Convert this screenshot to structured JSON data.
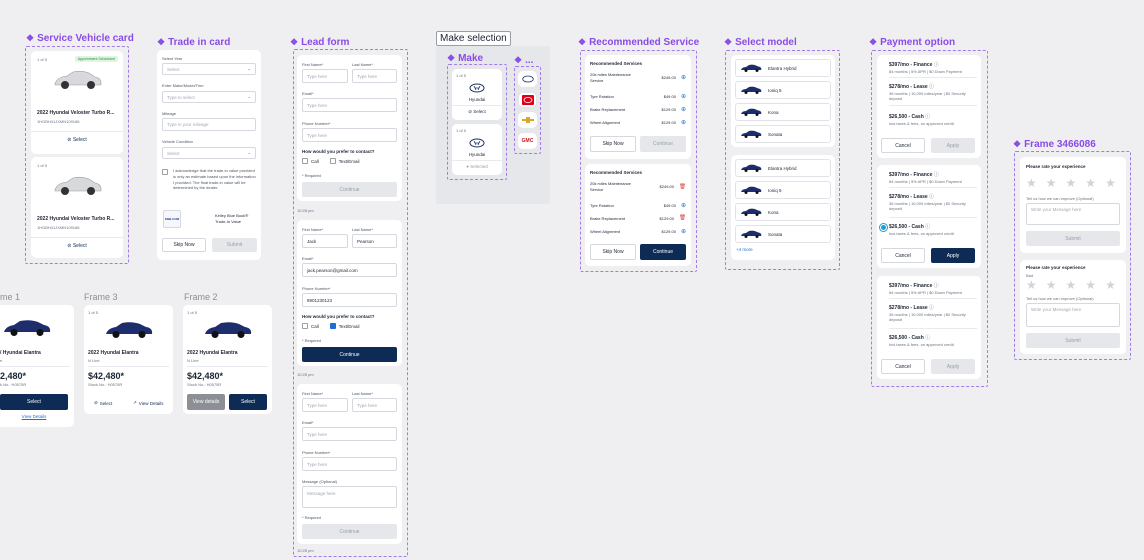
{
  "titles": {
    "service_vehicle_card": "Service Vehicle card",
    "trade_in_card": "Trade in card",
    "lead_form": "Lead form",
    "make_selection": "Make selection",
    "make": "Make",
    "make_more": "...",
    "recommended_service": "Recommended Service",
    "select_model": "Select model",
    "payment_option": "Payment option",
    "frame_3466086": "Frame 3466086",
    "frame_1": "me 1",
    "frame_3": "Frame 3",
    "frame_2": "Frame 2"
  },
  "service_vehicle": {
    "cards": [
      {
        "counter": "1 of 5",
        "badge": "Appointment Scheduled",
        "name": "2022 Hyundai Veloster Turbo R...",
        "vin": "1HGBH41JXMN109186",
        "select": "Select"
      },
      {
        "counter": "1 of 5",
        "name": "2022 Hyundai Veloster Turbo R...",
        "vin": "1HGBH41JXMN109186",
        "select": "Select"
      }
    ]
  },
  "trade_in": {
    "year_label": "Select Year",
    "year_ph": "Select",
    "mmt_label": "Enter Make/Model/Trim",
    "mmt_ph": "Type to select",
    "mileage_label": "Mileage",
    "mileage_ph": "Type in your mileage",
    "condition_label": "Vehicle Condition",
    "condition_ph": "Select",
    "ack": "I acknowledge that the trade-in value provided is only an estimate based upon the information I provided. The final trade-in value will be determined by the dealer.",
    "kbb_logo": "KBB.COM",
    "kbb_text": "Kelley Blue Book® Trade-In Value",
    "skip": "Skip Now",
    "submit": "Submit"
  },
  "lead_form": {
    "first_label": "First Name*",
    "last_label": "Last Name*",
    "email_label": "Email*",
    "phone_label": "Phone Number*",
    "ph_type": "Type here",
    "ph_email": "Type here",
    "ph_phone": "Type here",
    "prefer": "How would you prefer to contact?",
    "call": "Call",
    "text_email": "Text/Email",
    "required": "* Required",
    "continue": "Continue",
    "time1": "10:28 pm",
    "time2": "10:28 pm",
    "time3": "10:28 pm",
    "first_value": "Jack",
    "last_value": "Pearson",
    "email_value": "jack.pearson@gmail.com",
    "phone_value": "8901230123",
    "message_label": "Message (Optional)",
    "message_ph": "Message here"
  },
  "make": {
    "cards": [
      {
        "counter": "1 of 5",
        "name": "Hyundai",
        "action": "Select"
      },
      {
        "counter": "1 of 5",
        "name": "Hyundai",
        "action": "Selected"
      }
    ],
    "logos": [
      "hyundai-logo",
      "toyota-logo",
      "chevrolet-logo",
      "gmc-logo"
    ]
  },
  "recommended": {
    "heading": "Recommended Services",
    "items": [
      {
        "name": "20k miles Maintenance Service",
        "price": "$249.00"
      },
      {
        "name": "Tyre Rotation",
        "price": "$49.00"
      },
      {
        "name": "Brake Replacement",
        "price": "$129.00"
      },
      {
        "name": "Wheel Alignment",
        "price": "$129.00"
      }
    ],
    "skip": "Skip Now",
    "continue": "Continue"
  },
  "models": {
    "list1": [
      "Elantra Hybrid",
      "Ioniq 5",
      "Kona",
      "Sonata"
    ],
    "list2": [
      "Elantra Hybrid",
      "Ioniq 5",
      "Kona",
      "Sonata"
    ],
    "more": "+4 more"
  },
  "payment": {
    "options": [
      {
        "title": "$397/mo - Finance",
        "sub": "84 months | 5% APR | $0 Down Payment"
      },
      {
        "title": "$278/mo - Lease",
        "sub": "36 months | 10,000 miles/year | $0 Security deposit"
      },
      {
        "title": "$26,500 - Cash",
        "sub": "Incl.taxes & fees, on approved credit"
      }
    ],
    "cancel": "Cancel",
    "apply": "Apply"
  },
  "rating": {
    "title": "Please rate your experience",
    "rating_word": "Bad",
    "improve": "Tell us how we can improve (Optional)",
    "ph": "Write your Message here",
    "submit": "Submit"
  },
  "listing": {
    "counter": "1 of 5",
    "name": "2022 Hyundai Elantra",
    "trim": "N Line",
    "price": "$42,480*",
    "stock": "Stock No.: H0575R",
    "name_cut": "/ Hyundai Elantra",
    "trim_cut": "e",
    "price_cut": "2,480*",
    "stock_cut": "k No.: H0575R",
    "select": "Select",
    "view_details": "View Details",
    "view_details_lc": "View details"
  }
}
